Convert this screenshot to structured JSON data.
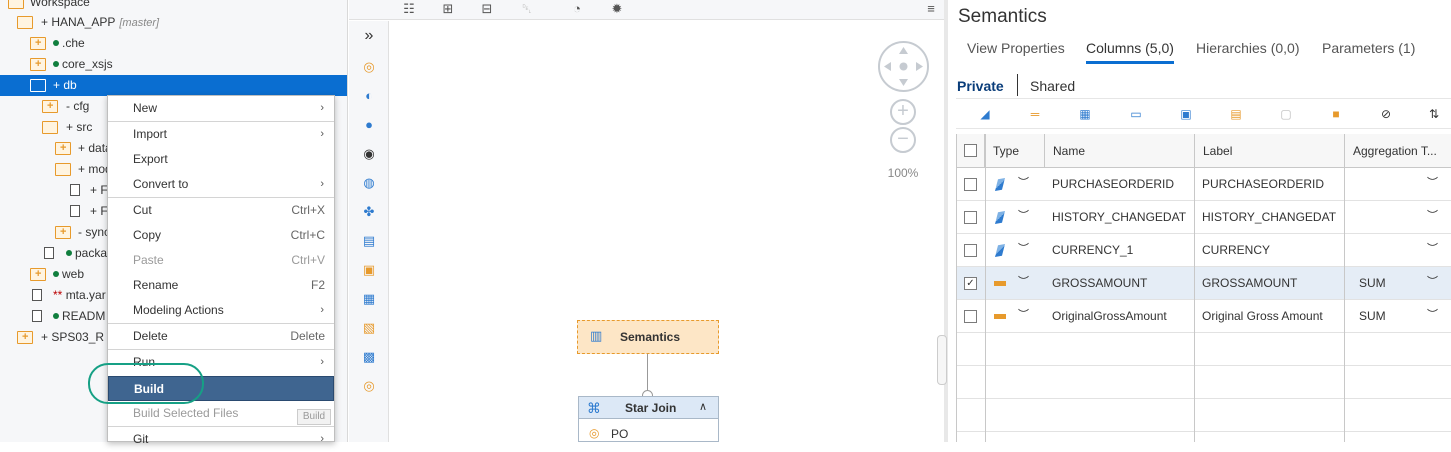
{
  "tree": {
    "items": [
      {
        "label": "Workspace",
        "icon": "folder-open-icon"
      },
      {
        "label": "+ HANA_APP",
        "branch": "[master]",
        "icon": "folder-open-icon"
      },
      {
        "label": ".che",
        "icon": "folder-icon"
      },
      {
        "label": "core_xsjs",
        "icon": "folder-icon"
      },
      {
        "label": "+ db",
        "icon": "folder-open-icon"
      },
      {
        "label": "- cfg",
        "icon": "folder-icon"
      },
      {
        "label": "+ src",
        "icon": "folder-open-icon"
      },
      {
        "label": "+ data",
        "icon": "folder-icon"
      },
      {
        "label": "+ mod",
        "icon": "folder-open-icon"
      },
      {
        "label": "+ F",
        "icon": "file-icon"
      },
      {
        "label": "+ F",
        "icon": "file-icon"
      },
      {
        "label": "- sync",
        "icon": "folder-icon"
      },
      {
        "label": "packa",
        "icon": "file-icon"
      },
      {
        "label": "web",
        "icon": "folder-icon"
      },
      {
        "label": "mta.yar",
        "stars": "**",
        "icon": "file-icon"
      },
      {
        "label": "READM",
        "icon": "file-icon"
      },
      {
        "label": "+ SPS03_R",
        "icon": "folder-icon"
      }
    ]
  },
  "context_menu": {
    "items": [
      {
        "label": "New",
        "shortcut": "",
        "submenu": true
      },
      {
        "label": "Import",
        "shortcut": "",
        "submenu": true
      },
      {
        "label": "Export",
        "shortcut": ""
      },
      {
        "label": "Convert to",
        "shortcut": "",
        "submenu": true
      },
      {
        "label": "Cut",
        "shortcut": "Ctrl+X"
      },
      {
        "label": "Copy",
        "shortcut": "Ctrl+C"
      },
      {
        "label": "Paste",
        "shortcut": "Ctrl+V",
        "disabled": true
      },
      {
        "label": "Rename",
        "shortcut": "F2"
      },
      {
        "label": "Modeling Actions",
        "shortcut": "",
        "submenu": true
      },
      {
        "label": "Delete",
        "shortcut": "Delete"
      },
      {
        "label": "Run",
        "shortcut": "",
        "submenu": true
      },
      {
        "label": "Build",
        "shortcut": "",
        "highlight": true
      },
      {
        "label": "Build Selected Files",
        "shortcut": "",
        "disabled": true
      },
      {
        "label": "Git",
        "shortcut": "",
        "submenu": true
      }
    ],
    "tooltip": "Build"
  },
  "editor": {
    "zoom": "100%",
    "nodes": {
      "semantics": "Semantics",
      "star_join": "Star Join",
      "star_join_input": "PO"
    }
  },
  "semantics_panel": {
    "title": "Semantics",
    "tabs": [
      "View Properties",
      "Columns (5,0)",
      "Hierarchies (0,0)",
      "Parameters (1)"
    ],
    "active_tab": "Columns (5,0)",
    "scope_private": "Private",
    "scope_shared": "Shared",
    "columns": [
      "Type",
      "Name",
      "Label",
      "Aggregation T..."
    ],
    "rows": [
      {
        "type": "attribute",
        "name": "PURCHASEORDERID",
        "label": "PURCHASEORDERID",
        "aggregation": "",
        "checked": false
      },
      {
        "type": "attribute",
        "name": "HISTORY_CHANGEDAT",
        "label": "HISTORY_CHANGEDAT",
        "aggregation": "",
        "checked": false
      },
      {
        "type": "attribute",
        "name": "CURRENCY_1",
        "label": "CURRENCY",
        "aggregation": "",
        "checked": false
      },
      {
        "type": "measure",
        "name": "GROSSAMOUNT",
        "label": "GROSSAMOUNT",
        "aggregation": "SUM",
        "checked": true
      },
      {
        "type": "measure",
        "name": "OriginalGrossAmount",
        "label": "Original Gross Amount",
        "aggregation": "SUM",
        "checked": false
      }
    ]
  },
  "colors": {
    "selection": "#0a6ed1",
    "menu_highlight": "#3f6590",
    "annotation_ring": "#16a085",
    "folder": "#e79a2c"
  }
}
